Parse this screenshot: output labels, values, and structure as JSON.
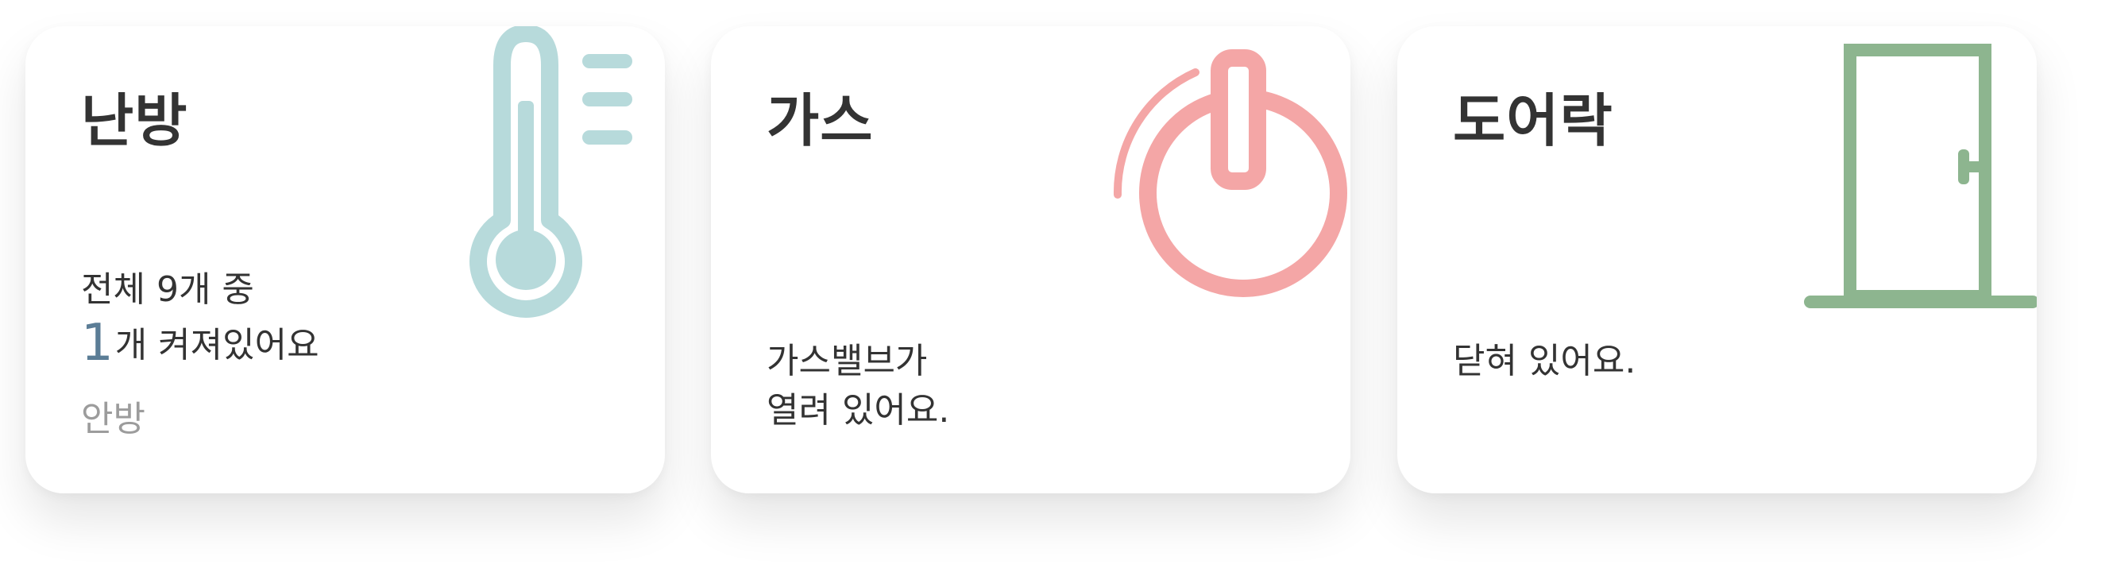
{
  "colors": {
    "thermometer": "#b7dadb",
    "power": "#f4a6a6",
    "door": "#8db58f",
    "count_highlight": "#5b7d96",
    "muted_text": "#9c9c9c"
  },
  "cards": {
    "heating": {
      "title": "난방",
      "summary_prefix": "전체 9개 중",
      "active_count": "1",
      "active_suffix": "개 켜져있어요",
      "room": "안방",
      "icon": "thermometer-icon"
    },
    "gas": {
      "title": "가스",
      "status_line1": "가스밸브가",
      "status_line2": "열려 있어요.",
      "icon": "power-icon"
    },
    "door": {
      "title": "도어락",
      "status_line1": "닫혀 있어요.",
      "icon": "door-icon"
    }
  }
}
